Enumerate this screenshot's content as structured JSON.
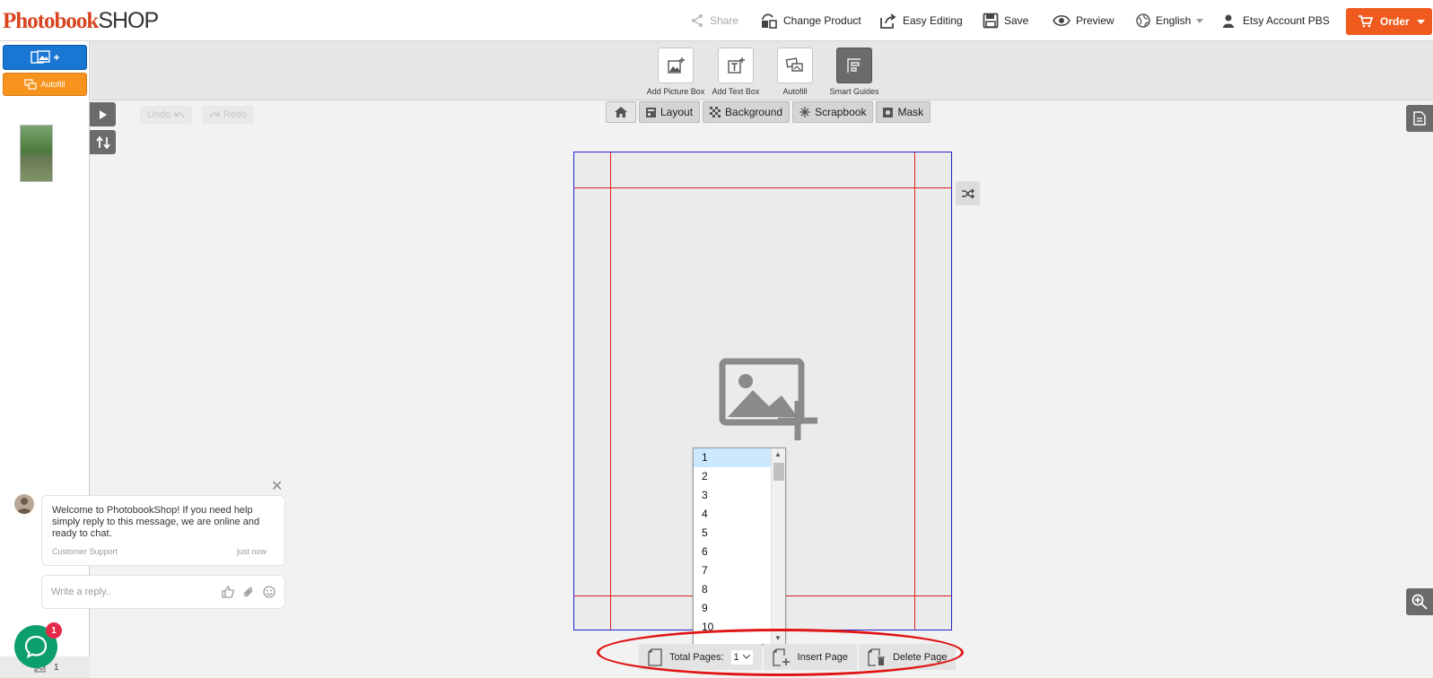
{
  "brand": {
    "part1": "Photobook",
    "part2": "SHOP"
  },
  "topnav": {
    "share": "Share",
    "change_product": "Change Product",
    "easy_editing": "Easy Editing",
    "save": "Save",
    "preview": "Preview",
    "language": "English",
    "account": "Etsy Account PBS",
    "order": "Order"
  },
  "sidebar": {
    "autofill_label": "Autofill",
    "photo_count": "1"
  },
  "tools": [
    {
      "label": "Add Picture Box",
      "icon": "add-picture-icon"
    },
    {
      "label": "Add Text Box",
      "icon": "add-text-icon"
    },
    {
      "label": "Autofill",
      "icon": "autofill-icon"
    },
    {
      "label": "Smart Guides",
      "icon": "smart-guides-icon"
    }
  ],
  "tabs": {
    "layout": "Layout",
    "background": "Background",
    "scrapbook": "Scrapbook",
    "mask": "Mask"
  },
  "history": {
    "undo": "Undo",
    "redo": "Redo"
  },
  "page_dropdown": {
    "options": [
      "1",
      "2",
      "3",
      "4",
      "5",
      "6",
      "7",
      "8",
      "9",
      "10"
    ],
    "selected": "1"
  },
  "bottom": {
    "total_pages_label": "Total Pages:",
    "total_pages_value": "1",
    "insert_page": "Insert Page",
    "delete_page": "Delete Page"
  },
  "chat": {
    "message": "Welcome to PhotobookShop! If you need help simply reply to this message, we are online and ready to chat.",
    "sender": "Customer Support",
    "time": "just now",
    "reply_placeholder": "Write a reply..",
    "badge": "1"
  },
  "colors": {
    "order": "#ef5a1f",
    "primary": "#1976d2",
    "autofill": "#f7941d",
    "guide": "#e02020",
    "annotation": "#e01515"
  }
}
